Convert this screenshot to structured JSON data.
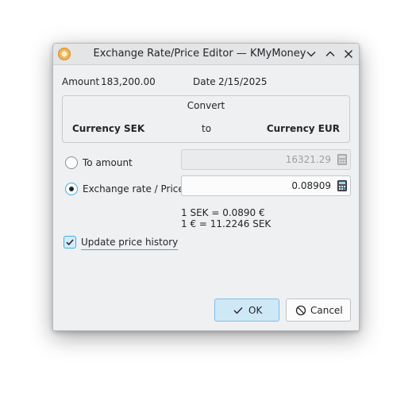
{
  "window": {
    "title": "Exchange Rate/Price Editor — KMyMoney"
  },
  "header": {
    "amount_label": "Amount",
    "amount_value": "183,200.00",
    "date_label": "Date",
    "date_value": "2/15/2025"
  },
  "convert": {
    "title": "Convert",
    "from_label": "Currency SEK",
    "to_word": "to",
    "to_label": "Currency EUR"
  },
  "options": {
    "to_amount_label": "To amount",
    "to_amount_value": "16321.29",
    "rate_label": "Exchange rate / Price",
    "rate_value": "0.08909",
    "selected": "rate"
  },
  "conversion_info": {
    "line1": "1 SEK = 0.0890 €",
    "line2": "1 € = 11.2246 SEK"
  },
  "update_history": {
    "label": "Update price history",
    "checked": true
  },
  "buttons": {
    "ok_label": "OK",
    "cancel_label": "Cancel"
  },
  "colors": {
    "accent": "#3daee9",
    "window_bg": "#eff0f1",
    "titlebar_bg": "#e3e5e7"
  }
}
